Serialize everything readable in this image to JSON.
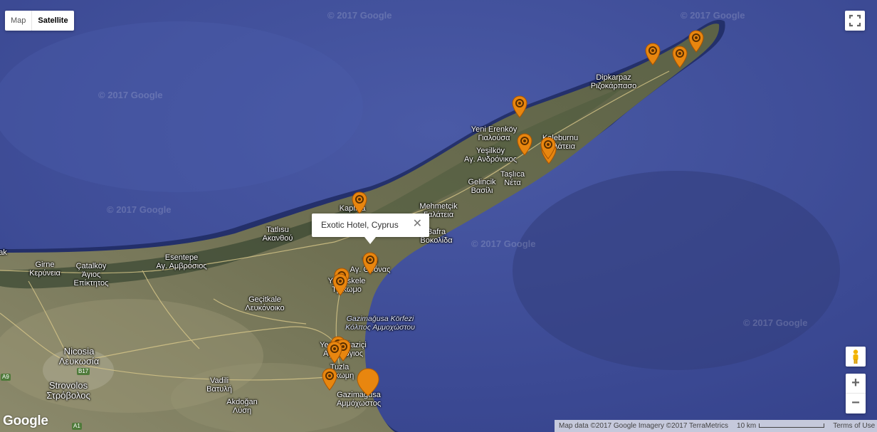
{
  "map_type": {
    "map_label": "Map",
    "satellite_label": "Satellite",
    "selected": "Satellite"
  },
  "controls": {
    "fullscreen_icon": "fullscreen-icon",
    "pegman_icon": "pegman-icon",
    "zoom_in": "+",
    "zoom_out": "−"
  },
  "info_window": {
    "title": "Exotic Hotel, Cyprus",
    "close": "✕"
  },
  "watermark": "© 2017 Google",
  "places": {
    "dipkarpaz": "Dipkarpaz\nΡιζοκάρπασο",
    "yeni_erenkoy": "Yeni Erenköy\nΓιαλούσα",
    "kaleburnu": "Kaleburnu\nΓαλάτεια",
    "yesilkoy": "Yeşilköy\nΑγ. Ανδρόνικος",
    "taslica": "Taşlıca\nΝέτα",
    "gelincik": "Gelincik\nΒασίλι",
    "mehmetcik": "Mehmetçik\nΓαλάτεια",
    "kaplica": "Kaplıca",
    "tatlisu": "Tatlısu\nΑκανθού",
    "bafra": "Bafra\nΒοκολίδα",
    "yeni_bogazici_top": "Yeni\nΑγ. Θρόνας",
    "esentepe": "Esentepe\nΑγ. Αμβρόσιος",
    "girne": "Girne\nΚερύνεια",
    "catalkoy": "Çatalköy\nΆγιος\nΕπίκτητος",
    "yeniiskele": "Yeni İskele\nΤρίκωμο",
    "gecitkale": "Geçitkale\nΛευκόνοικο",
    "gulf": "Gazimağusa Körfezi\nΚόλπος Αμμοχώστου",
    "nicosia": "Nicosia\nΛευκωσία",
    "yenibogazici": "Yeni Boğaziçi\nΑγ. Σέργιος",
    "tuzla": "Tuzla\nΈγκωμη",
    "vadili": "Vadili\nΒατυλή",
    "strovolos": "Strovolos\nΣτρόβολος",
    "akdogan": "Akdoğan\nΛύση",
    "gazimagusa": "Gazimağusa\nΑμμόχωστος",
    "ak_left": "ak"
  },
  "road_shields": {
    "b17": "B17",
    "a9": "A9",
    "a1": "A1"
  },
  "markers_count": 17,
  "colors": {
    "marker": "#e8860f",
    "sea": "#3f4f98",
    "land": "#7f7e60"
  },
  "footer": {
    "logo": "Google",
    "map_data": "Map data ©2017 Google Imagery ©2017 TerraMetrics",
    "scale": "10 km",
    "terms": "Terms of Use"
  }
}
